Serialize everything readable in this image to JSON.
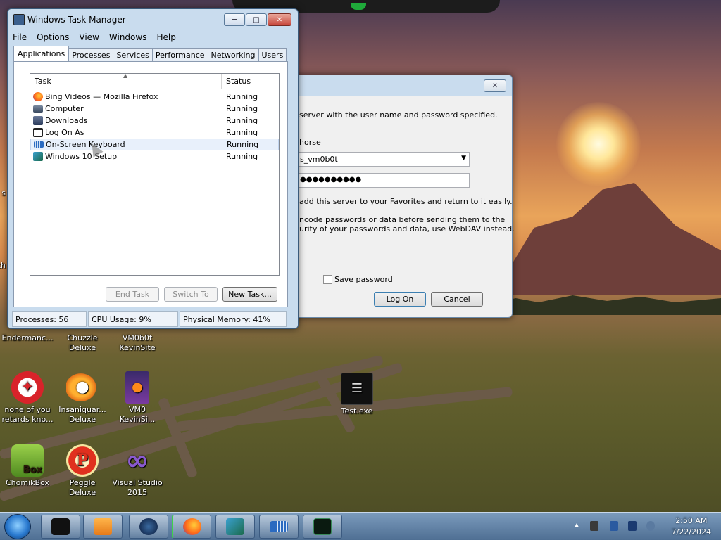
{
  "taskmanager": {
    "title": "Windows Task Manager",
    "menu": [
      "File",
      "Options",
      "View",
      "Windows",
      "Help"
    ],
    "tabs": [
      "Applications",
      "Processes",
      "Services",
      "Performance",
      "Networking",
      "Users"
    ],
    "columns": {
      "task": "Task",
      "status": "Status"
    },
    "rows": [
      {
        "task": "Bing Videos — Mozilla Firefox",
        "status": "Running",
        "icon": "firefox-icon"
      },
      {
        "task": "Computer",
        "status": "Running",
        "icon": "computer-icon"
      },
      {
        "task": "Downloads",
        "status": "Running",
        "icon": "folder-icon"
      },
      {
        "task": "Log On As",
        "status": "Running",
        "icon": "window-icon"
      },
      {
        "task": "On-Screen Keyboard",
        "status": "Running",
        "icon": "keyboard-icon"
      },
      {
        "task": "Windows 10 Setup",
        "status": "Running",
        "icon": "setup-icon"
      }
    ],
    "buttons": {
      "end_task": "End Task",
      "switch_to": "Switch To",
      "new_task": "New Task..."
    },
    "statusbar": {
      "processes": "Processes: 56",
      "cpu": "CPU Usage: 9%",
      "memory": "Physical Memory: 41%"
    }
  },
  "logon": {
    "message": "server with the user name and password specified.",
    "username_label": "horse",
    "username_value": "s_vm0b0t",
    "password_value": "●●●●●●●●●●",
    "favorites_text": "add this server to your Favorites and return to it easily.",
    "warning_line1": "ncode passwords or data before sending them to the",
    "warning_line2": "urity of your passwords and data, use WebDAV instead.",
    "save_password": "Save password",
    "logon_button": "Log On",
    "cancel_button": "Cancel",
    "close_glyph": "✕"
  },
  "desktop": {
    "edge_label_1": "s",
    "edge_label_2": "th",
    "icons": [
      {
        "label1": "Endermanc...",
        "label2": ""
      },
      {
        "label1": "Chuzzle",
        "label2": "Deluxe"
      },
      {
        "label1": "VM0b0t",
        "label2": "KevinSite"
      },
      {
        "label1": "none of you",
        "label2": "retards kno..."
      },
      {
        "label1": "Insaniquar...",
        "label2": "Deluxe"
      },
      {
        "label1": "VM0",
        "label2": "KevinSi..."
      },
      {
        "label1": "Test.exe",
        "label2": ""
      },
      {
        "label1": "ChomikBox",
        "label2": ""
      },
      {
        "label1": "Peggle Deluxe",
        "label2": ""
      },
      {
        "label1": "Visual Studio",
        "label2": "2015"
      }
    ],
    "chomik_badge": "Box",
    "peggle_badge": "P"
  },
  "taskbar": {
    "time": "2:50 AM",
    "date": "7/22/2024"
  },
  "colors": {
    "accent": "#3399ff",
    "titlebar": "#c9dcee"
  }
}
